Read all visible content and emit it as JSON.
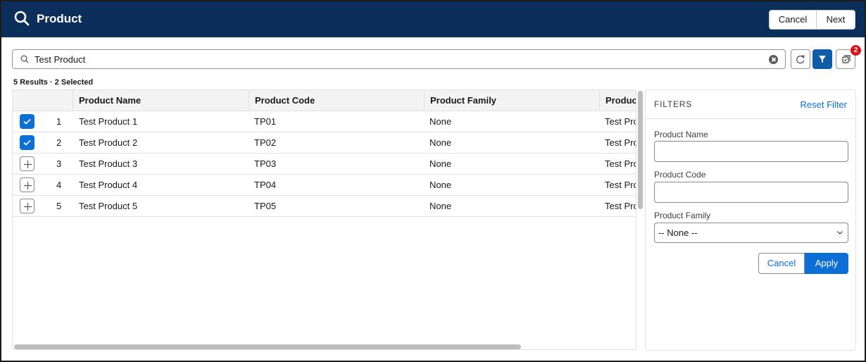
{
  "header": {
    "title": "Product",
    "cancel_label": "Cancel",
    "next_label": "Next"
  },
  "search": {
    "value": "Test Product"
  },
  "toolbar": {
    "selected_badge": "2"
  },
  "results_summary": "5 Results · 2 Selected",
  "table": {
    "columns": [
      "Product Name",
      "Product Code",
      "Product Family",
      "Product"
    ],
    "rows": [
      {
        "num": "1",
        "name": "Test Product 1",
        "code": "TP01",
        "family": "None",
        "extra": "Test Pro",
        "selected": true
      },
      {
        "num": "2",
        "name": "Test Product 2",
        "code": "TP02",
        "family": "None",
        "extra": "Test Pro",
        "selected": true
      },
      {
        "num": "3",
        "name": "Test Product 3",
        "code": "TP03",
        "family": "None",
        "extra": "Test Pro",
        "selected": false
      },
      {
        "num": "4",
        "name": "Test Product 4",
        "code": "TP04",
        "family": "None",
        "extra": "Test Pro",
        "selected": false
      },
      {
        "num": "5",
        "name": "Test Product 5",
        "code": "TP05",
        "family": "None",
        "extra": "Test Pro",
        "selected": false
      }
    ]
  },
  "filters": {
    "heading": "FILTERS",
    "reset_label": "Reset Filter",
    "product_name_label": "Product Name",
    "product_name_value": "",
    "product_code_label": "Product Code",
    "product_code_value": "",
    "product_family_label": "Product Family",
    "product_family_value": "-- None --",
    "cancel_label": "Cancel",
    "apply_label": "Apply"
  },
  "colors": {
    "header_bg": "#0b2e5b",
    "accent": "#0b6fd6",
    "badge": "#e0101b"
  }
}
